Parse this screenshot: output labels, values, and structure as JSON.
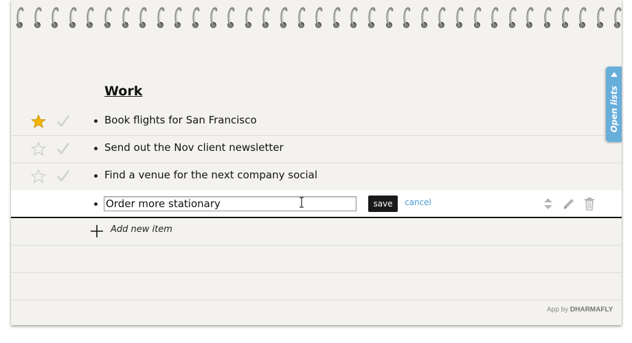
{
  "list": {
    "title": "Work",
    "items": [
      {
        "text": "Book flights for San Francisco",
        "starred": true
      },
      {
        "text": "Send out the Nov client newsletter",
        "starred": false
      },
      {
        "text": "Find a venue for the next company social",
        "starred": false
      }
    ],
    "editing_item": {
      "value": "Order more stationary"
    },
    "save_label": "save",
    "cancel_label": "cancel",
    "add_item_label": "Add new item"
  },
  "side_tab": {
    "label": "Open lists"
  },
  "credit": {
    "prefix": "App by",
    "brand": "DHARMAFLY"
  },
  "icons": {
    "star_on": "star-filled-icon",
    "star_off": "star-outline-icon",
    "check": "check-icon",
    "reorder": "reorder-arrows-icon",
    "edit": "pencil-icon",
    "delete": "trash-icon",
    "add": "plus-icon",
    "open_lists": "triangle-up-icon"
  },
  "colors": {
    "paper": "#f3f2ef",
    "star": "#f2b600",
    "accent_blue": "#68aedb",
    "link": "#4a9ad3"
  }
}
